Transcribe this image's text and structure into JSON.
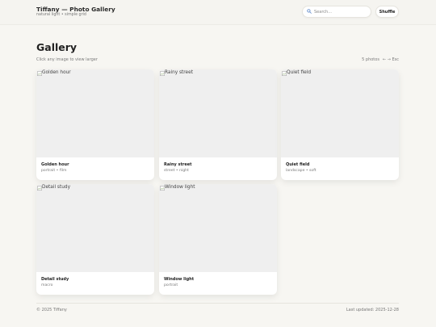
{
  "app": {
    "title": "Tiffany — Photo Gallery",
    "subtitle": "natural light • simple grid"
  },
  "search": {
    "placeholder": "Search...",
    "value": "",
    "icon": "search-icon"
  },
  "toolbar": {
    "shuffle_label": "Shuffle"
  },
  "page": {
    "title": "Gallery",
    "subtitle": "Click any image to view larger",
    "count_label": "5 photos",
    "nav_hint": "← → Esc"
  },
  "photos": [
    {
      "alt": "Golden hour",
      "title": "Golden hour",
      "tags": "portrait • film"
    },
    {
      "alt": "Rainy street",
      "title": "Rainy street",
      "tags": "street • night"
    },
    {
      "alt": "Quiet field",
      "title": "Quiet field",
      "tags": "landscape • soft"
    },
    {
      "alt": "Detail study",
      "title": "Detail study",
      "tags": "macro"
    },
    {
      "alt": "Window light",
      "title": "Window light",
      "tags": "portrait"
    }
  ],
  "footer": {
    "copyright": "© 2025 Tiffany",
    "updated": "Last updated: 2025-12-28"
  },
  "colors": {
    "background": "#f7f6f2",
    "card": "#ffffff",
    "image_placeholder": "#efefef"
  }
}
